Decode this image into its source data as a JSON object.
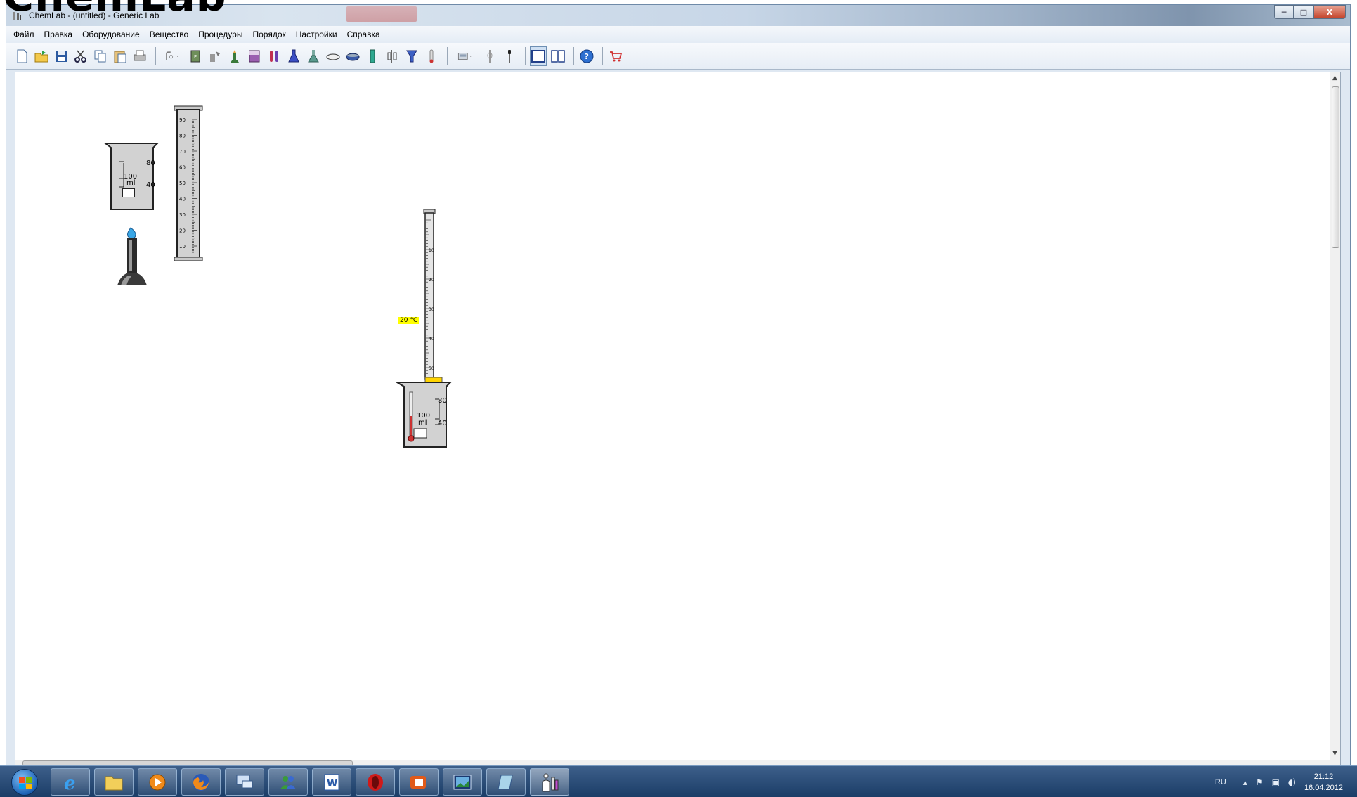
{
  "window": {
    "title": "ChemLab - (untitled) - Generic Lab",
    "overlay_text": "ChemLab",
    "buttons": {
      "minimize": "─",
      "maximize": "□",
      "close": "X"
    }
  },
  "menu": [
    "Файл",
    "Правка",
    "Оборудование",
    "Вещество",
    "Процедуры",
    "Порядок",
    "Настройки",
    "Справка"
  ],
  "toolbar": {
    "icons": [
      "new-file",
      "open-file",
      "save",
      "cut",
      "copy",
      "paste",
      "print",
      "clamp-dropdown",
      "flask-stand",
      "weighing-paper",
      "bunsen-burner",
      "beaker",
      "test-tubes",
      "erlenmeyer-flask",
      "round-flask",
      "watch-glass",
      "evaporating-dish",
      "graduated-cylinder",
      "burette-stand",
      "funnel",
      "thermometer",
      "balance-dropdown",
      "pipette",
      "dropper",
      "view-single",
      "view-split",
      "help",
      "shop"
    ]
  },
  "lab": {
    "beaker1": {
      "marks": [
        "80",
        "100",
        "ml",
        "40"
      ]
    },
    "cylinder_marks": [
      "90",
      "80",
      "70",
      "60",
      "50",
      "40",
      "30",
      "20",
      "10"
    ],
    "burette_marks": [
      "10",
      "20",
      "30",
      "40",
      "50"
    ],
    "beaker2": {
      "marks": [
        "80",
        "100",
        "ml",
        "40"
      ],
      "temperature": "20 °C"
    }
  },
  "taskbar": {
    "apps": [
      "internet-explorer",
      "explorer",
      "media-player",
      "firefox",
      "remote-desktop",
      "messenger",
      "word",
      "opera",
      "acrobat",
      "photo-viewer",
      "notepad",
      "chemlab"
    ],
    "language": "RU",
    "time": "21:12",
    "date": "16.04.2012"
  },
  "colors": {
    "accent": "#1b3d67",
    "flame": "#3aa7e6",
    "temp_badge": "#ffff00"
  }
}
